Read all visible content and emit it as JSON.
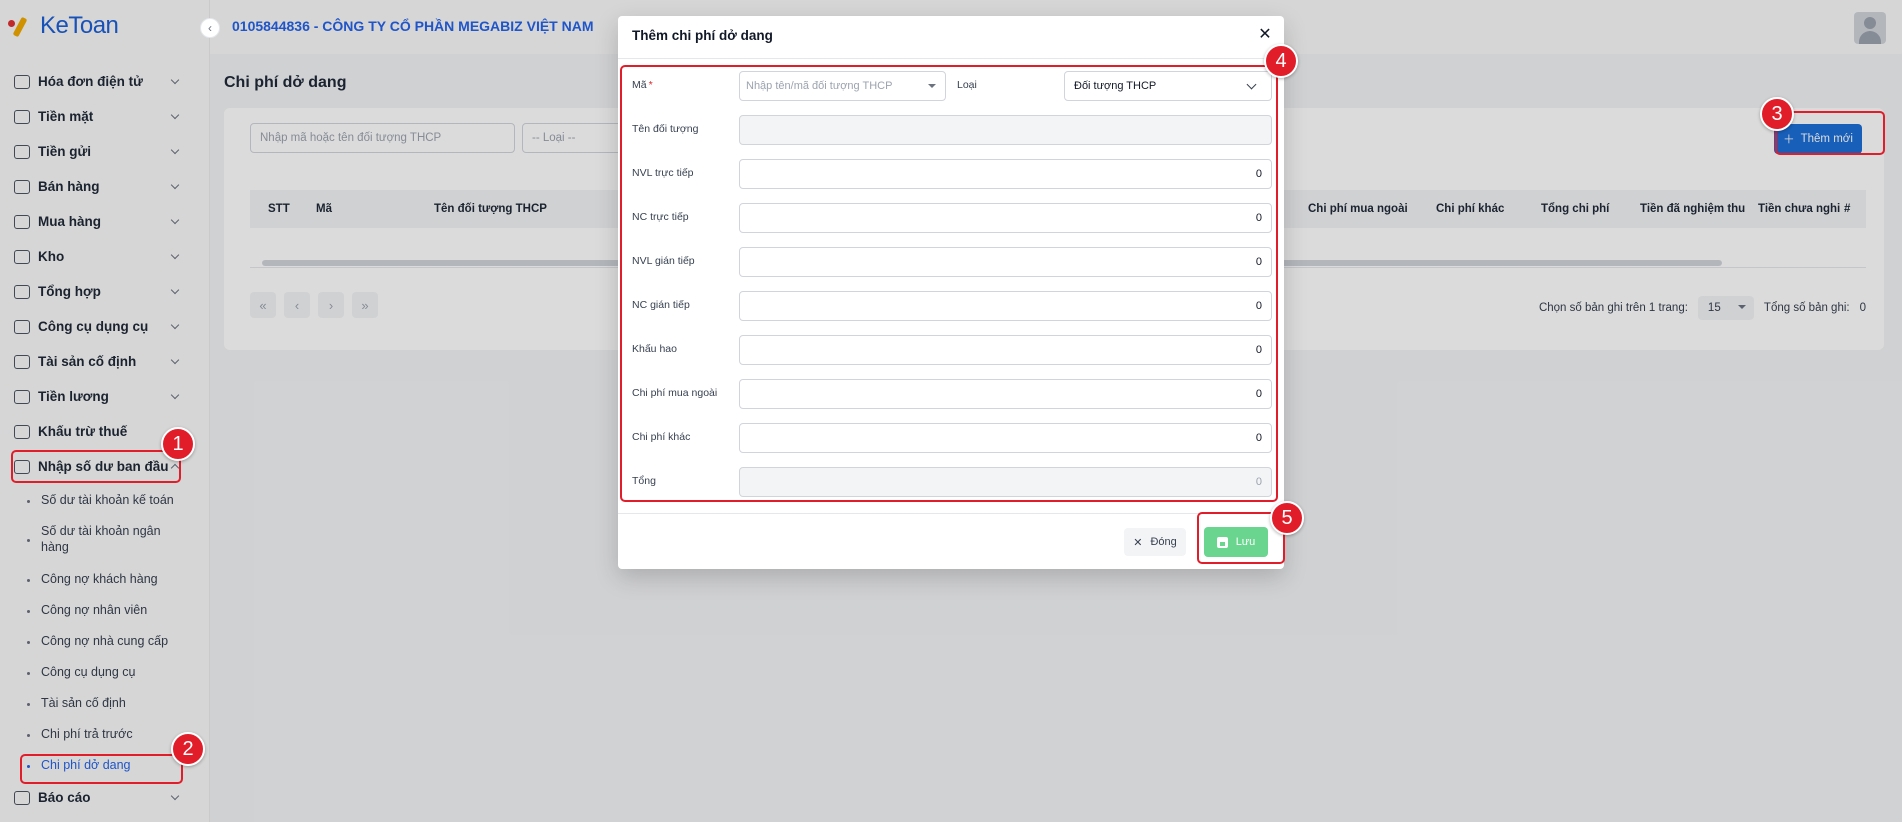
{
  "brand": {
    "logo_text": "KeToan"
  },
  "header": {
    "company": "0105844836 - CÔNG TY CỔ PHẦN MEGABIZ VIỆT NAM"
  },
  "sidebar": {
    "items": [
      {
        "label": "Hóa đơn điện tử",
        "icon": "invoice-icon"
      },
      {
        "label": "Tiền mặt",
        "icon": "cash-icon"
      },
      {
        "label": "Tiền gửi",
        "icon": "bank-deposit-icon"
      },
      {
        "label": "Bán hàng",
        "icon": "sales-icon"
      },
      {
        "label": "Mua hàng",
        "icon": "purchase-icon"
      },
      {
        "label": "Kho",
        "icon": "warehouse-icon"
      },
      {
        "label": "Tổng hợp",
        "icon": "chart-icon"
      },
      {
        "label": "Công cụ dụng cụ",
        "icon": "tools-icon"
      },
      {
        "label": "Tài sản cố định",
        "icon": "asset-icon"
      },
      {
        "label": "Tiền lương",
        "icon": "salary-icon"
      },
      {
        "label": "Khấu trừ thuế",
        "icon": "tax-icon"
      },
      {
        "label": "Nhập số dư ban đầu",
        "icon": "edit-icon"
      }
    ],
    "subitems": [
      "Số dư tài khoản kế toán",
      "Số dư tài khoản ngân hàng",
      "Công nợ khách hàng",
      "Công nợ nhân viên",
      "Công nợ nhà cung cấp",
      "Công cụ dụng cụ",
      "Tài sản cố định",
      "Chi phí trả trước",
      "Chi phí dở dang"
    ],
    "last_item": {
      "label": "Báo cáo",
      "icon": "report-icon"
    }
  },
  "page": {
    "title": "Chi phí dở dang",
    "search_placeholder": "Nhập mã hoặc tên đối tượng THCP",
    "type_placeholder": "-- Loại --",
    "add_button": "Thêm mới",
    "columns": [
      "STT",
      "Mã",
      "Tên đối tượng THCP",
      "Chi phí mua ngoài",
      "Chi phí khác",
      "Tổng chi phí",
      "Tiền đã nghiệm thu",
      "Tiền chưa nghi",
      "#"
    ],
    "per_page_label": "Chọn số bản ghi trên 1 trang:",
    "per_page_value": "15",
    "total_label": "Tổng số bản ghi:",
    "total_value": "0"
  },
  "modal": {
    "title": "Thêm chi phí dở dang",
    "ma_label": "Mã",
    "required_mark": "*",
    "ma_placeholder": "Nhập tên/mã đối tượng THCP",
    "loai_label": "Loại",
    "loai_value": "Đối tượng THCP",
    "fields": [
      {
        "label": "Tên đối tượng",
        "value": ""
      },
      {
        "label": "NVL trực tiếp",
        "value": "0"
      },
      {
        "label": "NC trực tiếp",
        "value": "0"
      },
      {
        "label": "NVL gián tiếp",
        "value": "0"
      },
      {
        "label": "NC gián tiếp",
        "value": "0"
      },
      {
        "label": "Khấu hao",
        "value": "0"
      },
      {
        "label": "Chi phí mua ngoài",
        "value": "0"
      },
      {
        "label": "Chi phí khác",
        "value": "0"
      },
      {
        "label": "Tổng",
        "value": "0"
      }
    ],
    "close_button": "Đóng",
    "save_button": "Lưu"
  },
  "annotations": [
    "1",
    "2",
    "3",
    "4",
    "5"
  ],
  "colors": {
    "accent": "#1d6fd8",
    "annotation": "#e11d2a",
    "save": "#6ad58f"
  }
}
